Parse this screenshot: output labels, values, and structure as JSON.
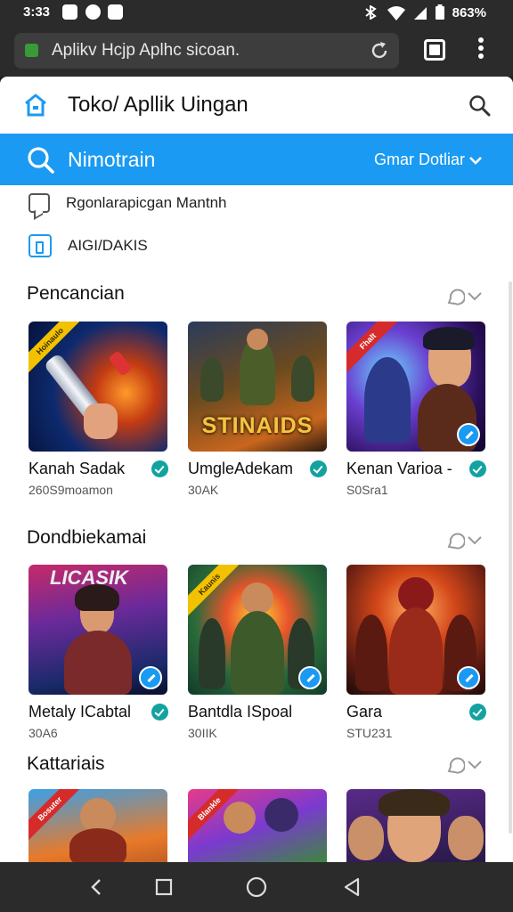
{
  "status_bar": {
    "time": "3:33",
    "battery": "863%"
  },
  "browser": {
    "url": "Aplikv Hcjp Aplhc sicoan."
  },
  "header": {
    "title": "Toko/ Apllik Uingan"
  },
  "search": {
    "query": "Nimotrain",
    "filter_label": "Gmar Dotliar"
  },
  "quick_links": [
    {
      "label": "Rgonlarapicgan Mantnh",
      "icon": "chat-icon"
    },
    {
      "label": "AIGI/DAKIS",
      "icon": "app-box-icon"
    }
  ],
  "sections": [
    {
      "title": "Pencancian",
      "apps": [
        {
          "name": "Kanah Sadak",
          "meta": "260S9moamon",
          "ribbon": "Hoinaulo",
          "ribbon_color": "#f2c200",
          "tile_label": "",
          "art": "saber",
          "verified_overlay": false
        },
        {
          "name": "UmgleAdekam",
          "meta": "30AK",
          "ribbon": "",
          "ribbon_color": "",
          "tile_label": "STINAIDS",
          "art": "soldier",
          "verified_overlay": false
        },
        {
          "name": "Kenan Varioa -",
          "meta": "S0Sra1",
          "ribbon": "Fhalt",
          "ribbon_color": "#d62b2b",
          "tile_label": "",
          "art": "hero-purple",
          "verified_overlay": true
        }
      ]
    },
    {
      "title": "Dondbiekamai",
      "apps": [
        {
          "name": "Metaly ICabtal",
          "meta": "30A6",
          "ribbon": "",
          "ribbon_color": "",
          "tile_label": "LICASIK",
          "art": "warrior-woman",
          "verified_overlay": true
        },
        {
          "name": "Bantdla ISpoal",
          "meta": "30IIK",
          "ribbon": "Kaunis",
          "ribbon_color": "#f2c200",
          "tile_label": "",
          "art": "soldier-fire",
          "verified_overlay": true
        },
        {
          "name": "Gara",
          "meta": "STU231",
          "ribbon": "",
          "ribbon_color": "",
          "tile_label": "",
          "art": "red-squad",
          "verified_overlay": true
        }
      ]
    },
    {
      "title": "Kattariais",
      "apps": [
        {
          "ribbon": "Bosuter",
          "ribbon_color": "#d62b2b",
          "art": "squad-warm"
        },
        {
          "ribbon": "Blankle",
          "ribbon_color": "#d62b2b",
          "art": "squad-rainbow"
        },
        {
          "ribbon": "",
          "ribbon_color": "",
          "art": "heroes-purple"
        }
      ]
    }
  ],
  "colors": {
    "accent": "#1a9af2",
    "badge": "#12a3a0"
  }
}
